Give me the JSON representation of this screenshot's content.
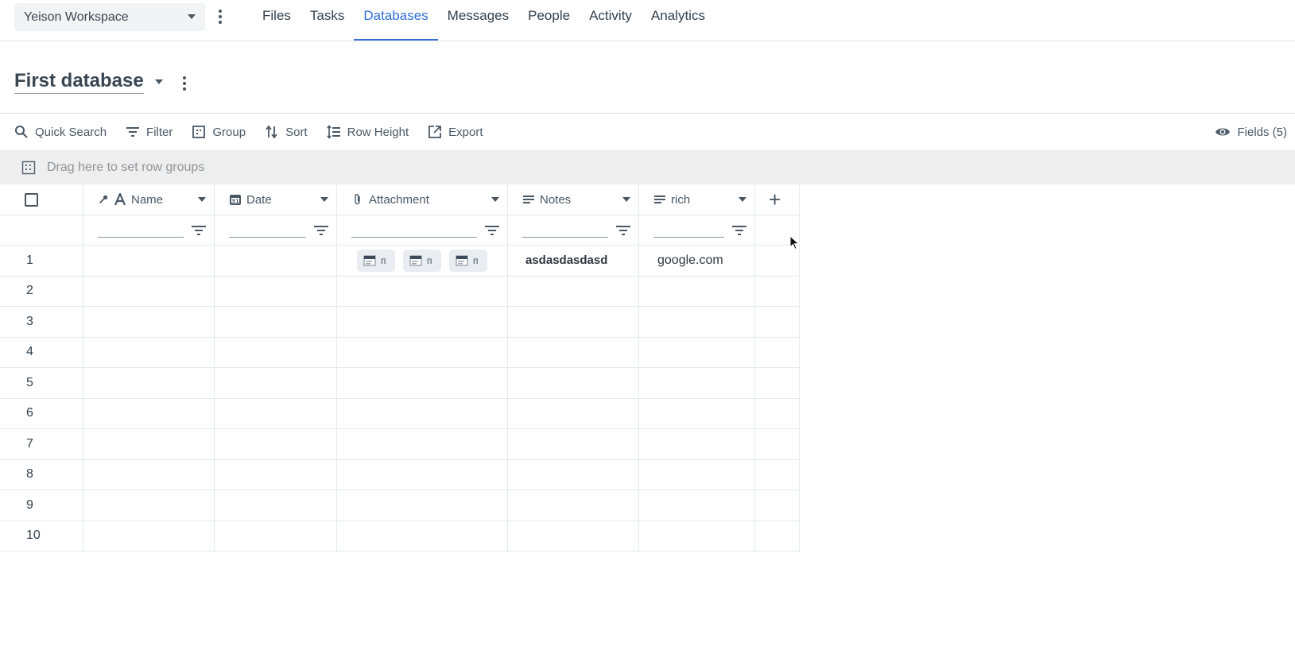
{
  "workspace": {
    "name": "Yeison Workspace"
  },
  "nav": {
    "tabs": [
      {
        "label": "Files"
      },
      {
        "label": "Tasks"
      },
      {
        "label": "Databases",
        "active": true
      },
      {
        "label": "Messages"
      },
      {
        "label": "People"
      },
      {
        "label": "Activity"
      },
      {
        "label": "Analytics"
      }
    ]
  },
  "database": {
    "title": "First database"
  },
  "toolbar": {
    "quick_search": "Quick Search",
    "filter": "Filter",
    "group": "Group",
    "sort": "Sort",
    "row_height": "Row Height",
    "export": "Export",
    "fields": "Fields (5)"
  },
  "groupbar": {
    "placeholder": "Drag here to set row groups"
  },
  "columns": [
    {
      "label": "Name",
      "icon": "text-icon"
    },
    {
      "label": "Date",
      "icon": "calendar-icon"
    },
    {
      "label": "Attachment",
      "icon": "paperclip-icon"
    },
    {
      "label": "Notes",
      "icon": "lines-icon"
    },
    {
      "label": "rich",
      "icon": "lines-icon"
    }
  ],
  "rows": [
    {
      "num": "1",
      "notes": "asdasdasdasd",
      "rich": "google.com",
      "attachments": [
        "п",
        "п",
        "п"
      ]
    },
    {
      "num": "2"
    },
    {
      "num": "3"
    },
    {
      "num": "4"
    },
    {
      "num": "5"
    },
    {
      "num": "6"
    },
    {
      "num": "7"
    },
    {
      "num": "8"
    },
    {
      "num": "9"
    },
    {
      "num": "10"
    }
  ],
  "colors": {
    "accent": "#2f6fd6",
    "text": "#33414e",
    "groupbar_bg": "#eeeeee"
  }
}
